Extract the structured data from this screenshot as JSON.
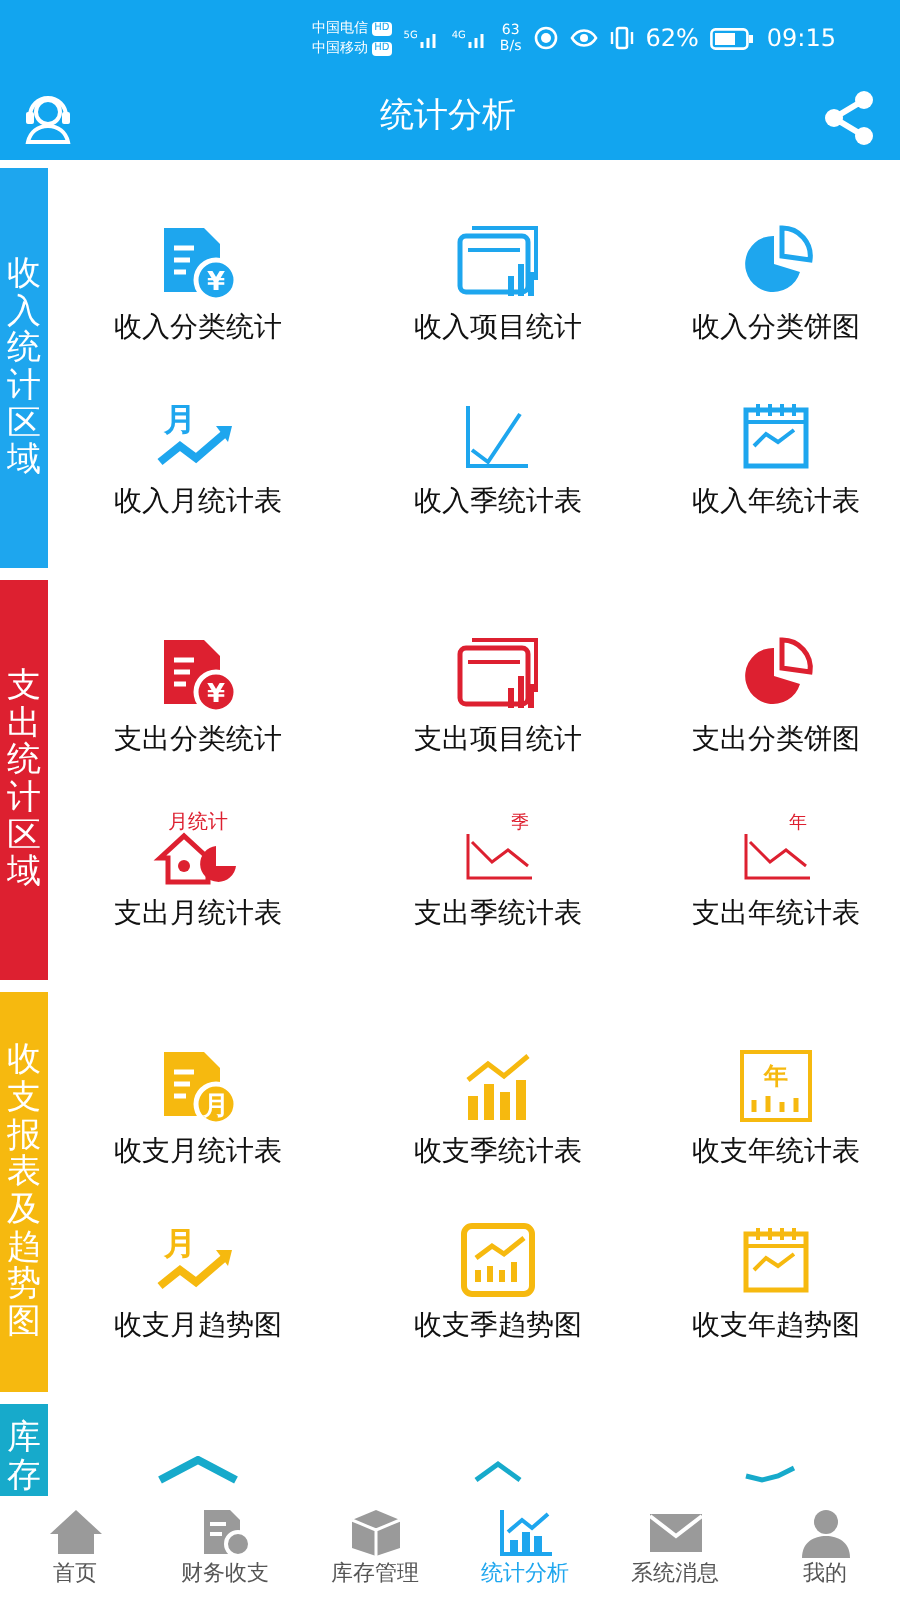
{
  "status_bar": {
    "carriers": [
      {
        "name": "中国电信",
        "hd": "HD"
      },
      {
        "name": "中国移动",
        "hd": "HD"
      }
    ],
    "signals": [
      "5G",
      "4G"
    ],
    "speed": "63",
    "speed_unit": "B/s",
    "battery": "62%",
    "time": "09:15"
  },
  "header": {
    "title": "统计分析"
  },
  "sections": [
    {
      "label": "收入统计区域",
      "color": "#1ea6ee",
      "items": [
        {
          "label": "收入分类统计",
          "kind": "doc-coin",
          "icon_text": "¥"
        },
        {
          "label": "收入项目统计",
          "kind": "card-bars"
        },
        {
          "label": "收入分类饼图",
          "kind": "pie"
        },
        {
          "label": "收入月统计表",
          "kind": "month-trend",
          "icon_text": "月"
        },
        {
          "label": "收入季统计表",
          "kind": "line-chart"
        },
        {
          "label": "收入年统计表",
          "kind": "calendar-wave"
        }
      ]
    },
    {
      "label": "支出统计区域",
      "color": "#dd2030",
      "items": [
        {
          "label": "支出分类统计",
          "kind": "doc-coin",
          "icon_text": "¥"
        },
        {
          "label": "支出项目统计",
          "kind": "card-bars"
        },
        {
          "label": "支出分类饼图",
          "kind": "pie"
        },
        {
          "label": "支出月统计表",
          "kind": "house-pie",
          "icon_text": "月统计"
        },
        {
          "label": "支出季统计表",
          "kind": "down-chart",
          "icon_text": "季"
        },
        {
          "label": "支出年统计表",
          "kind": "down-chart",
          "icon_text": "年"
        }
      ]
    },
    {
      "label": "收支报表及趋势图",
      "color": "#f6b90f",
      "items": [
        {
          "label": "收支月统计表",
          "kind": "doc-coin",
          "icon_text": "月"
        },
        {
          "label": "收支季统计表",
          "kind": "bars-trend"
        },
        {
          "label": "收支年统计表",
          "kind": "frame-bars",
          "icon_text": "年"
        },
        {
          "label": "收支月趋势图",
          "kind": "month-trend",
          "icon_text": "月"
        },
        {
          "label": "收支季趋势图",
          "kind": "screen-bars"
        },
        {
          "label": "收支年趋势图",
          "kind": "calendar-wave"
        }
      ]
    },
    {
      "label": "库存",
      "color": "#17aacb",
      "items": [
        {
          "kind": "roof"
        },
        {
          "kind": "chevron"
        },
        {
          "kind": "wave"
        }
      ]
    }
  ],
  "bottom_nav": [
    {
      "label": "首页",
      "kind": "home",
      "selected": false
    },
    {
      "label": "财务收支",
      "kind": "doc-coin",
      "selected": false
    },
    {
      "label": "库存管理",
      "kind": "box",
      "selected": false
    },
    {
      "label": "统计分析",
      "kind": "chart",
      "selected": true
    },
    {
      "label": "系统消息",
      "kind": "mail",
      "selected": false
    },
    {
      "label": "我的",
      "kind": "person",
      "selected": false
    }
  ]
}
